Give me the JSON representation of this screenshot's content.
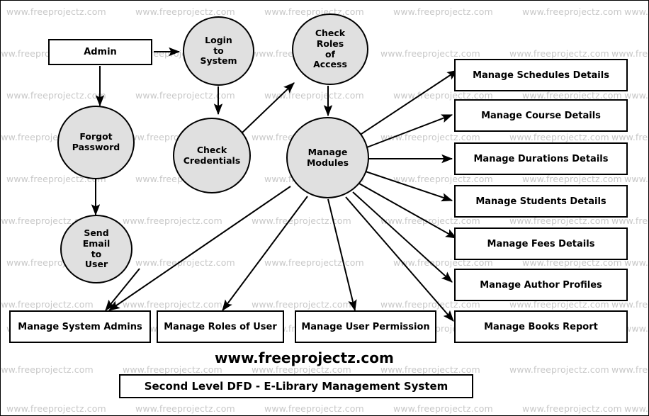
{
  "diagram": {
    "title": "Second Level DFD - E-Library Management System",
    "site_label": "www.freeprojectz.com",
    "watermark_text": "www.freeprojectz.com",
    "colors": {
      "process_fill": "#e0e0e0",
      "node_stroke": "#000000",
      "store_fill": "#ffffff",
      "watermark": "#c8c8c8",
      "canvas": "#ffffff"
    }
  },
  "entities": [
    {
      "id": "admin",
      "label": "Admin"
    }
  ],
  "processes": [
    {
      "id": "login-to-system",
      "label": "Login\nto\nSystem",
      "lines": [
        "Login",
        "to",
        "System"
      ]
    },
    {
      "id": "check-roles-access",
      "label": "Check\nRoles\nof\nAccess",
      "lines": [
        "Check",
        "Roles",
        "of",
        "Access"
      ]
    },
    {
      "id": "forgot-password",
      "label": "Forgot\nPassword",
      "lines": [
        "Forgot",
        "Password"
      ]
    },
    {
      "id": "check-credentials",
      "label": "Check\nCredentials",
      "lines": [
        "Check",
        "Credentials"
      ]
    },
    {
      "id": "send-email-to-user",
      "label": "Send\nEmail\nto\nUser",
      "lines": [
        "Send",
        "Email",
        "to",
        "User"
      ]
    },
    {
      "id": "manage-modules",
      "label": "Manage\nModules",
      "lines": [
        "Manage",
        "Modules"
      ]
    }
  ],
  "right_stores": [
    {
      "id": "manage-schedules-details",
      "label": "Manage Schedules Details"
    },
    {
      "id": "manage-course-details",
      "label": "Manage Course Details"
    },
    {
      "id": "manage-durations-details",
      "label": "Manage Durations Details"
    },
    {
      "id": "manage-students-details",
      "label": "Manage Students Details"
    },
    {
      "id": "manage-fees-details",
      "label": "Manage Fees Details"
    },
    {
      "id": "manage-author-profiles",
      "label": "Manage Author Profiles"
    },
    {
      "id": "manage-books-report",
      "label": "Manage Books Report"
    }
  ],
  "bottom_stores": [
    {
      "id": "manage-system-admins",
      "label": "Manage System Admins"
    },
    {
      "id": "manage-roles-of-user",
      "label": "Manage Roles of User"
    },
    {
      "id": "manage-user-permission",
      "label": "Manage User Permission"
    }
  ],
  "flows": [
    {
      "from": "admin",
      "to": "login-to-system"
    },
    {
      "from": "admin",
      "to": "forgot-password"
    },
    {
      "from": "login-to-system",
      "to": "check-credentials"
    },
    {
      "from": "check-credentials",
      "to": "check-roles-access"
    },
    {
      "from": "check-roles-access",
      "to": "manage-modules"
    },
    {
      "from": "forgot-password",
      "to": "send-email-to-user"
    },
    {
      "from": "send-email-to-user",
      "to": "manage-system-admins"
    },
    {
      "from": "manage-modules",
      "to": "manage-schedules-details"
    },
    {
      "from": "manage-modules",
      "to": "manage-course-details"
    },
    {
      "from": "manage-modules",
      "to": "manage-durations-details"
    },
    {
      "from": "manage-modules",
      "to": "manage-students-details"
    },
    {
      "from": "manage-modules",
      "to": "manage-fees-details"
    },
    {
      "from": "manage-modules",
      "to": "manage-author-profiles"
    },
    {
      "from": "manage-modules",
      "to": "manage-books-report"
    },
    {
      "from": "manage-modules",
      "to": "manage-system-admins"
    },
    {
      "from": "manage-modules",
      "to": "manage-roles-of-user"
    },
    {
      "from": "manage-modules",
      "to": "manage-user-permission"
    }
  ]
}
